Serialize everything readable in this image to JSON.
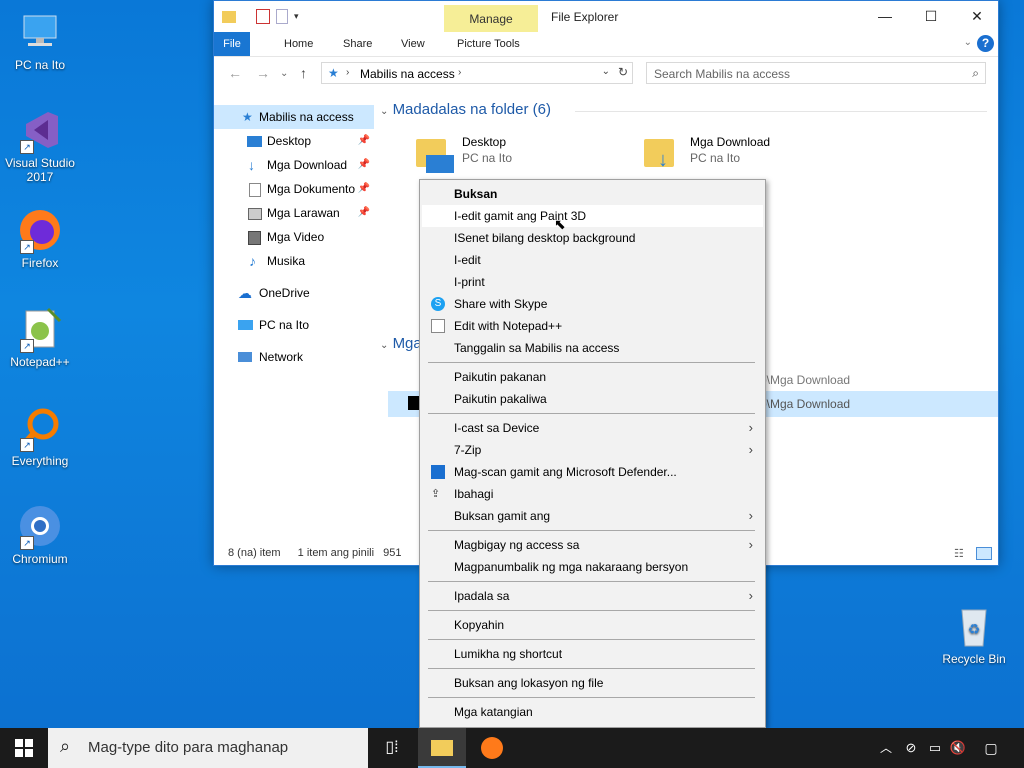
{
  "desktop": {
    "icons": [
      {
        "label": "PC na Ito"
      },
      {
        "label": "Visual Studio 2017"
      },
      {
        "label": "Firefox"
      },
      {
        "label": "Notepad++"
      },
      {
        "label": "Everything"
      },
      {
        "label": "Chromium"
      },
      {
        "label": "Recycle Bin"
      }
    ]
  },
  "explorer": {
    "title": "File Explorer",
    "manage_tab": "Manage",
    "ribbon_tabs": [
      "File",
      "Home",
      "Share",
      "View",
      "Picture Tools"
    ],
    "help": "?",
    "address": "Mabilis na access",
    "search_placeholder": "Search Mabilis na access",
    "nav": [
      {
        "label": "Mabilis na access",
        "selected": true
      },
      {
        "label": "Desktop",
        "pinned": true
      },
      {
        "label": "Mga Download",
        "pinned": true
      },
      {
        "label": "Mga Dokumento",
        "pinned": true
      },
      {
        "label": "Mga Larawan",
        "pinned": true
      },
      {
        "label": "Mga Video"
      },
      {
        "label": "Musika"
      },
      {
        "label": "OneDrive"
      },
      {
        "label": "PC na Ito"
      },
      {
        "label": "Network"
      }
    ],
    "group_frequent": "Madadalas na folder (6)",
    "group_recent": "Mga",
    "folders": [
      {
        "name": "Desktop",
        "sub": "PC na Ito"
      },
      {
        "name": "Mga Download",
        "sub": "PC na Ito"
      }
    ],
    "recent_paths": [
      "o\\Mga Download",
      "o\\Mga Download"
    ],
    "status": {
      "count": "8 (na) item",
      "selected": "1 item ang pinili",
      "size": "951"
    }
  },
  "context_menu": {
    "items": [
      {
        "label": "Buksan",
        "bold": true
      },
      {
        "label": "I-edit gamit ang Paint 3D",
        "highlighted": true
      },
      {
        "label": "ISenet bilang desktop background"
      },
      {
        "label": "I-edit"
      },
      {
        "label": "I-print"
      },
      {
        "label": "Share with Skype",
        "icon": "skype-icon"
      },
      {
        "label": "Edit with Notepad++",
        "icon": "notepadpp-icon"
      },
      {
        "label": "Tanggalin sa Mabilis na access"
      },
      {
        "label": "Paikutin pakanan"
      },
      {
        "label": "Paikutin pakaliwa"
      },
      {
        "label": "I-cast sa Device",
        "submenu": true
      },
      {
        "label": "7-Zip",
        "submenu": true
      },
      {
        "label": "Mag-scan gamit ang Microsoft Defender...",
        "icon": "defender-icon"
      },
      {
        "label": "Ibahagi",
        "icon": "share-icon"
      },
      {
        "label": "Buksan gamit ang",
        "submenu": true
      },
      {
        "label": "Magbigay ng access sa",
        "submenu": true
      },
      {
        "label": "Magpanumbalik ng mga nakaraang bersyon"
      },
      {
        "label": "Ipadala sa",
        "submenu": true
      },
      {
        "label": "Kopyahin"
      },
      {
        "label": "Lumikha ng shortcut"
      },
      {
        "label": "Buksan ang lokasyon ng file"
      },
      {
        "label": "Mga katangian"
      }
    ]
  },
  "taskbar": {
    "search_placeholder": "Mag-type dito para maghanap"
  },
  "colors": {
    "accent": "#1976d2",
    "manage": "#f6ee97",
    "selected": "#cce8ff"
  }
}
